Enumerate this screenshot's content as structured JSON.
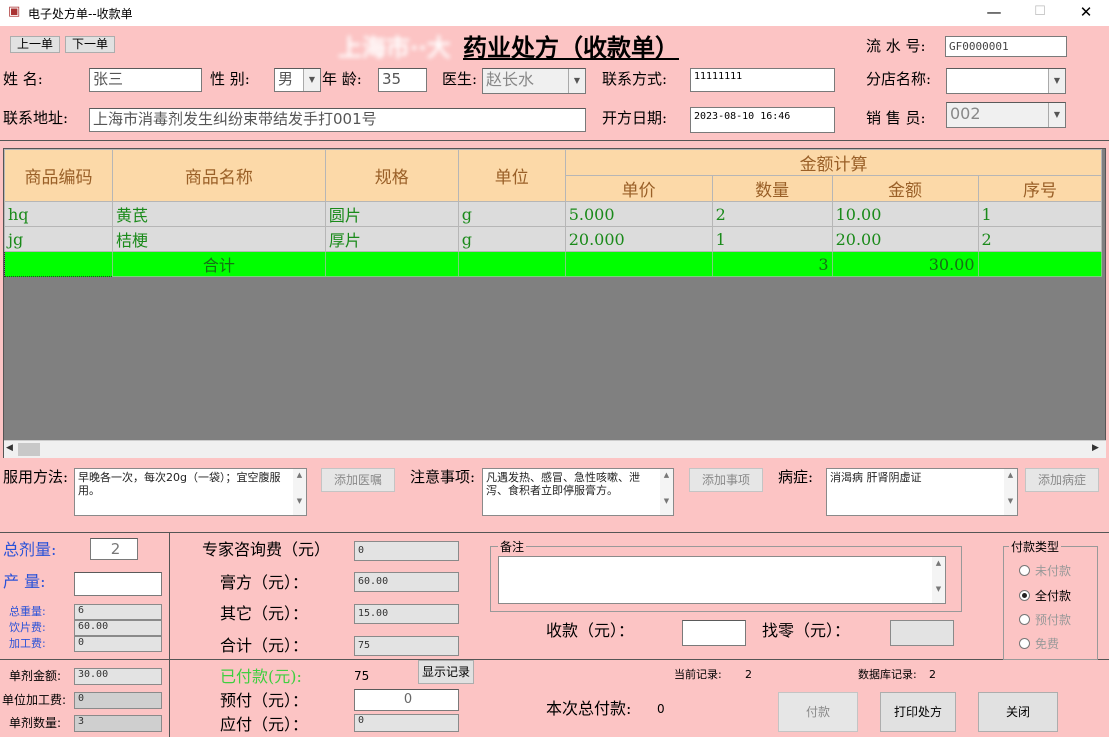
{
  "window": {
    "title": "电子处方单--收款单",
    "minimize": "—",
    "maximize": "☐",
    "close": "✕"
  },
  "nav": {
    "prev": "上一单",
    "next": "下一单"
  },
  "header": {
    "title_hidden": "上海市··大",
    "title": "药业处方（收款单）"
  },
  "serial": {
    "label": "流 水 号:",
    "value": "GF0000001"
  },
  "patient": {
    "name_label": "姓    名:",
    "name": "张三",
    "gender_label": "性  别:",
    "gender": "男",
    "age_label": "年  龄:",
    "age": "35",
    "doctor_label": "医生:",
    "doctor": "赵长水",
    "contact_label": "联系方式:",
    "contact": "11111111",
    "branch_label": "分店名称:",
    "branch": "",
    "address_label": "联系地址:",
    "address": "上海市消毒剂发生纠纷束带结发手打001号",
    "date_label": "开方日期:",
    "date": "2023-08-10 16:46",
    "sales_label": "销 售 员:",
    "sales": "002"
  },
  "table": {
    "headers": {
      "code": "商品编码",
      "name": "商品名称",
      "spec": "规格",
      "unit": "单位",
      "group": "金额计算",
      "price": "单价",
      "qty": "数量",
      "amount": "金额",
      "seq": "序号"
    },
    "rows": [
      {
        "code": "hq",
        "name": "黄芪",
        "spec": "圆片",
        "unit": "g",
        "price": "5.000",
        "qty": "2",
        "amount": "10.00",
        "seq": "1"
      },
      {
        "code": "jg",
        "name": "桔梗",
        "spec": "厚片",
        "unit": "g",
        "price": "20.000",
        "qty": "1",
        "amount": "20.00",
        "seq": "2"
      }
    ],
    "total": {
      "label": "合计",
      "qty": "3",
      "amount": "30.00"
    }
  },
  "usage": {
    "label": "服用方法:",
    "text": "早晚各一次，每次20g（一袋）；宜空腹服用。",
    "button": "添加医嘱"
  },
  "notes": {
    "label": "注意事项:",
    "text": "凡遇发热、感冒、急性咳嗽、泄泻、食积者立即停服膏方。",
    "button": "添加事项"
  },
  "disease": {
    "label": "病症:",
    "text": "消渴病  肝肾阴虚证",
    "button": "添加病症"
  },
  "dose": {
    "total_label": "总剂量:",
    "total": "2",
    "output_label": "产  量:",
    "output": "",
    "weight_label": "总重量:",
    "weight": "6",
    "decoction_label": "饮片费:",
    "decoction": "60.00",
    "processing_label": "加工费:",
    "processing": "0"
  },
  "fees": {
    "consult_label": "专家咨询费（元）",
    "consult": "0",
    "paste_label": "膏方（元）：",
    "paste": "60.00",
    "other_label": "其它（元）：",
    "other": "15.00",
    "sum_label": "合计（元）：",
    "sum": "75"
  },
  "remark": {
    "label": "备注",
    "text": ""
  },
  "payment_type": {
    "label": "付款类型",
    "options": [
      "未付款",
      "全付款",
      "预付款",
      "免费"
    ],
    "selected": "全付款"
  },
  "receive": {
    "label": "收款（元）：",
    "value": "",
    "change_label": "找零（元）：",
    "change": ""
  },
  "bottom": {
    "unit_amount_label": "单剂金额:",
    "unit_amount": "30.00",
    "unit_process_label": "单位加工费:",
    "unit_process": "0",
    "unit_count_label": "单剂数量:",
    "unit_count": "3",
    "paid_label": "已付款(元):",
    "paid": "75",
    "show_record": "显示记录",
    "prepay_label": "预付（元）：",
    "prepay": "0",
    "due_label": "应付（元）：",
    "due": "0",
    "current_label": "当前记录:",
    "current": "2",
    "db_label": "数据库记录:",
    "db": "2",
    "total_pay_label": "本次总付款:",
    "total_pay": "0",
    "pay_button": "付款",
    "print_button": "打印处方",
    "close_button": "关闭"
  },
  "colors": {
    "background": "#fcc4c4",
    "header": "#fcd9a8",
    "total_row": "#00ff00",
    "grid_bg": "#808080",
    "green_text": "#1a8a1a"
  }
}
